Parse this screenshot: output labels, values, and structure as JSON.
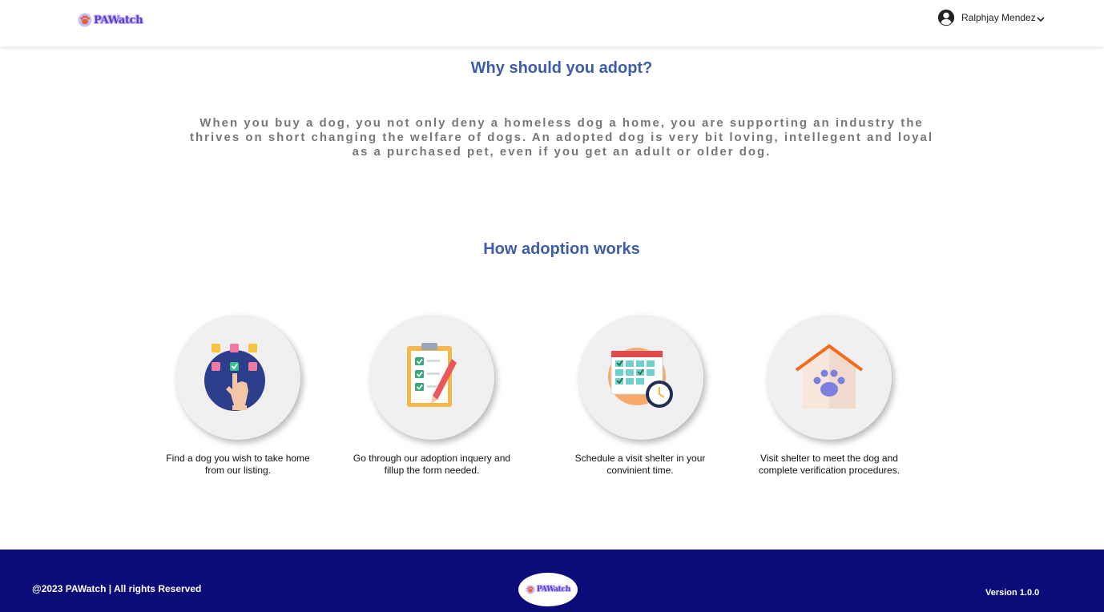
{
  "header": {
    "brand": "PAWatch",
    "user_name": "Ralphjay Mendez",
    "avatar_icon": "account-circle-icon",
    "chevron_icon": "chevron-down-icon"
  },
  "why": {
    "title": "Why should you adopt?",
    "text": "When you buy a dog, you not only deny a homeless dog a home, you are supporting an industry the thrives on short changing the welfare of dogs. An adopted dog is very bit loving, intellegent and loyal as a purchased pet, even if you get an adult or older dog."
  },
  "how": {
    "title": "How adoption works",
    "steps": [
      {
        "icon": "tap-select-icon",
        "text": "Find a dog you wish to take home from our listing."
      },
      {
        "icon": "checklist-form-icon",
        "text": "Go through our adoption inquery and fillup the form needed."
      },
      {
        "icon": "calendar-clock-icon",
        "text": "Schedule a visit shelter in your convinient time."
      },
      {
        "icon": "shelter-paw-icon",
        "text": "Visit shelter to meet the dog and complete verification procedures."
      }
    ]
  },
  "footer": {
    "copyright": "@2023 PAWatch | All rights Reserved",
    "brand": "PAWatch",
    "version": "Version 1.0.0"
  },
  "colors": {
    "title_blue": "#3d5da6",
    "footer_navy": "#0b0b7a",
    "brand_purple": "#5b3fc9"
  }
}
